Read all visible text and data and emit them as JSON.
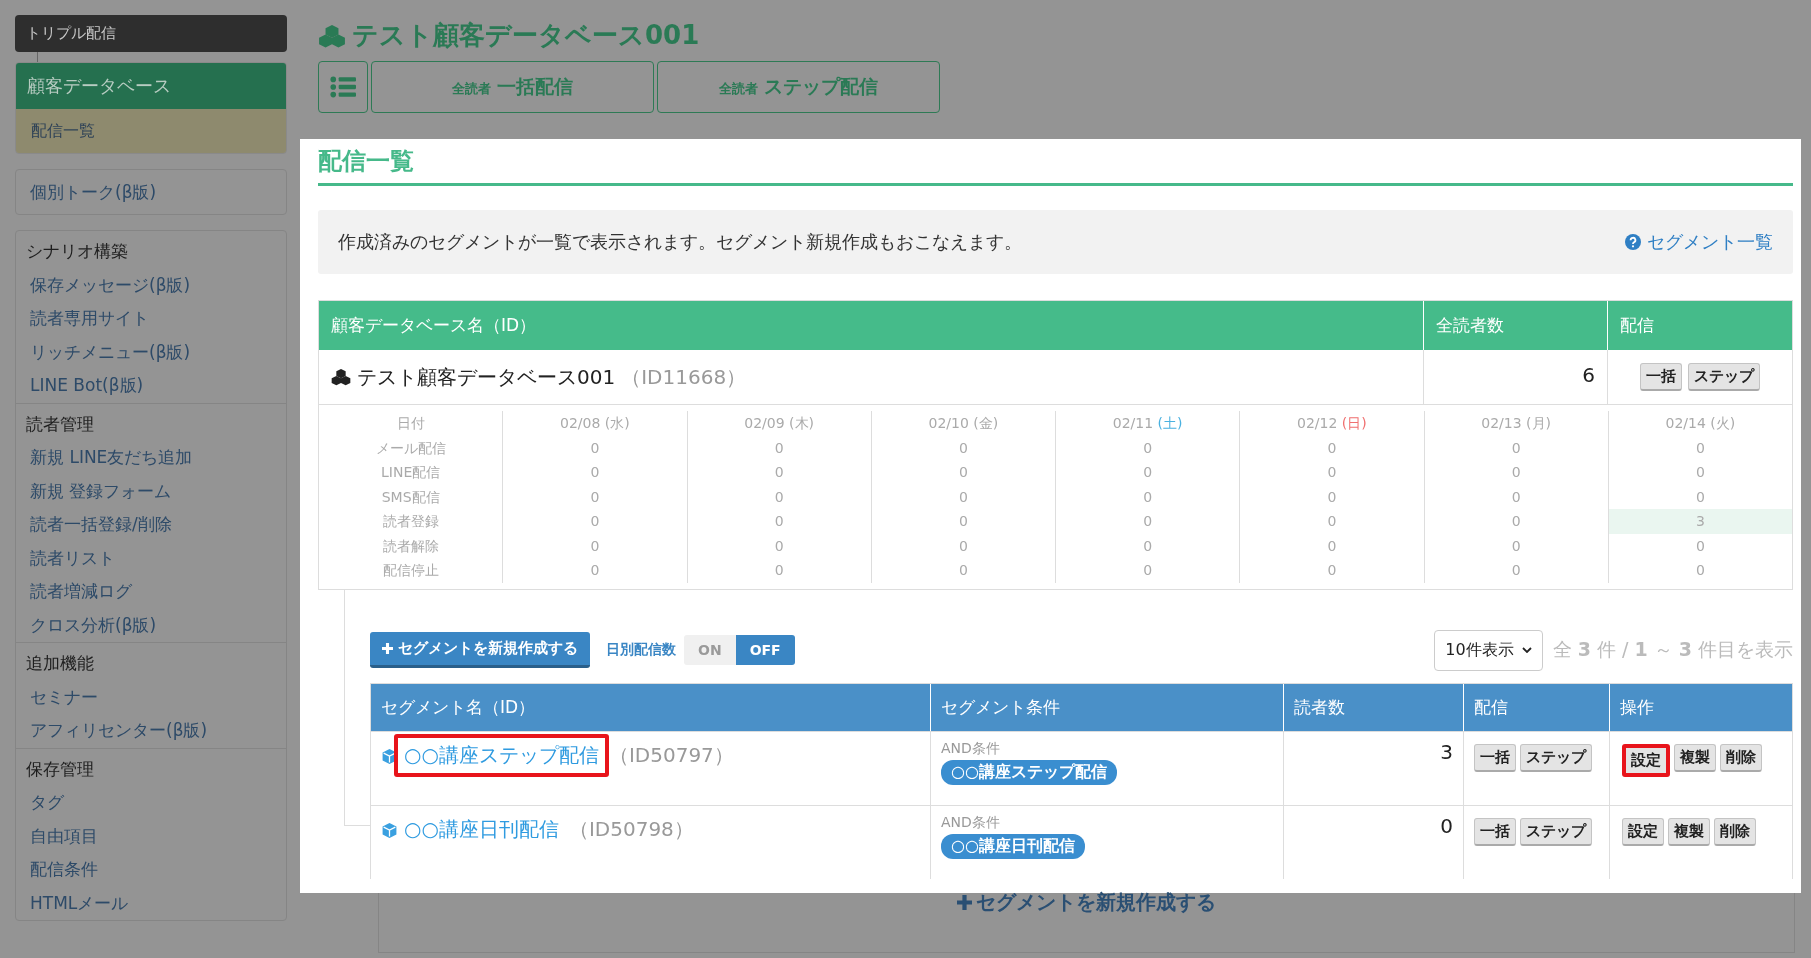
{
  "sidebar": {
    "brand": "トリプル配信",
    "current_group": "顧客データベース",
    "current_item": "配信一覧",
    "single": "個別トーク(β版)",
    "sections": [
      {
        "title": "シナリオ構築",
        "items": [
          "保存メッセージ(β版)",
          "読者専用サイト",
          "リッチメニュー(β版)",
          "LINE Bot(β版)"
        ]
      },
      {
        "title": "読者管理",
        "items": [
          "新規 LINE友だち追加",
          "新規 登録フォーム",
          "読者一括登録/削除",
          "読者リスト",
          "読者増減ログ",
          "クロス分析(β版)"
        ]
      },
      {
        "title": "追加機能",
        "items": [
          "セミナー",
          "アフィリセンター(β版)"
        ]
      },
      {
        "title": "保存管理",
        "items": [
          "タグ",
          "自由項目",
          "配信条件",
          "HTMLメール"
        ]
      }
    ]
  },
  "page_title": "テスト顧客データベース001",
  "top_buttons": [
    {
      "small": "全読者",
      "label": "一括配信"
    },
    {
      "small": "全読者",
      "label": "ステップ配信"
    }
  ],
  "panel": {
    "title": "配信一覧",
    "info": "作成済みのセグメントが一覧で表示されます。セグメント新規作成もおこなえます。",
    "help_link": "セグメント一覧",
    "db_table": {
      "columns": [
        "顧客データベース名（ID）",
        "全読者数",
        "配信"
      ],
      "name": "テスト顧客データベース001",
      "id": "（ID11668）",
      "count": "6",
      "buttons": [
        "一括",
        "ステップ"
      ]
    },
    "stats": {
      "corner": "日付",
      "days": [
        {
          "date": "02/08",
          "weekday": "(水)",
          "kind": "weekday"
        },
        {
          "date": "02/09",
          "weekday": "(木)",
          "kind": "weekday"
        },
        {
          "date": "02/10",
          "weekday": "(金)",
          "kind": "weekday"
        },
        {
          "date": "02/11",
          "weekday": "(土)",
          "kind": "saturday"
        },
        {
          "date": "02/12",
          "weekday": "(日)",
          "kind": "sunday"
        },
        {
          "date": "02/13",
          "weekday": "(月)",
          "kind": "weekday"
        },
        {
          "date": "02/14",
          "weekday": "(火)",
          "kind": "weekday"
        }
      ],
      "rows": [
        {
          "label": "メール配信",
          "values": [
            {
              "value": "0",
              "highlighted": false
            },
            {
              "value": "0",
              "highlighted": false
            },
            {
              "value": "0",
              "highlighted": false
            },
            {
              "value": "0",
              "highlighted": false
            },
            {
              "value": "0",
              "highlighted": false
            },
            {
              "value": "0",
              "highlighted": false
            },
            {
              "value": "0",
              "highlighted": false
            }
          ]
        },
        {
          "label": "LINE配信",
          "values": [
            {
              "value": "0",
              "highlighted": false
            },
            {
              "value": "0",
              "highlighted": false
            },
            {
              "value": "0",
              "highlighted": false
            },
            {
              "value": "0",
              "highlighted": false
            },
            {
              "value": "0",
              "highlighted": false
            },
            {
              "value": "0",
              "highlighted": false
            },
            {
              "value": "0",
              "highlighted": false
            }
          ]
        },
        {
          "label": "SMS配信",
          "values": [
            {
              "value": "0",
              "highlighted": false
            },
            {
              "value": "0",
              "highlighted": false
            },
            {
              "value": "0",
              "highlighted": false
            },
            {
              "value": "0",
              "highlighted": false
            },
            {
              "value": "0",
              "highlighted": false
            },
            {
              "value": "0",
              "highlighted": false
            },
            {
              "value": "0",
              "highlighted": false
            }
          ]
        },
        {
          "label": "読者登録",
          "values": [
            {
              "value": "0",
              "highlighted": false
            },
            {
              "value": "0",
              "highlighted": false
            },
            {
              "value": "0",
              "highlighted": false
            },
            {
              "value": "0",
              "highlighted": false
            },
            {
              "value": "0",
              "highlighted": false
            },
            {
              "value": "0",
              "highlighted": false
            },
            {
              "value": "3",
              "highlighted": true
            }
          ]
        },
        {
          "label": "読者解除",
          "values": [
            {
              "value": "0",
              "highlighted": false
            },
            {
              "value": "0",
              "highlighted": false
            },
            {
              "value": "0",
              "highlighted": false
            },
            {
              "value": "0",
              "highlighted": false
            },
            {
              "value": "0",
              "highlighted": false
            },
            {
              "value": "0",
              "highlighted": false
            },
            {
              "value": "0",
              "highlighted": false
            }
          ]
        },
        {
          "label": "配信停止",
          "values": [
            {
              "value": "0",
              "highlighted": false
            },
            {
              "value": "0",
              "highlighted": false
            },
            {
              "value": "0",
              "highlighted": false
            },
            {
              "value": "0",
              "highlighted": false
            },
            {
              "value": "0",
              "highlighted": false
            },
            {
              "value": "0",
              "highlighted": false
            },
            {
              "value": "0",
              "highlighted": false
            }
          ]
        }
      ]
    },
    "new_segment_button": "セグメントを新規作成する",
    "daily_toggle": {
      "label": "日別配信数",
      "on_label": "ON",
      "off_label": "OFF",
      "on": false
    },
    "page_size": "10件表示",
    "pagination": "全 **3** 件 / **1** ～ **3** 件目を表示",
    "segment_table": {
      "columns": [
        "セグメント名（ID）",
        "セグメント条件",
        "読者数",
        "配信",
        "操作"
      ],
      "rows": [
        {
          "name": "○○講座ステップ配信",
          "id": "（ID50797）",
          "name_highlighted": true,
          "condition_label": "AND条件",
          "condition": "○○講座ステップ配信",
          "count": "3",
          "delivery": [
            "一括",
            "ステップ"
          ],
          "actions": [
            {
              "label": "設定",
              "highlighted": true
            },
            {
              "label": "複製",
              "highlighted": false
            },
            {
              "label": "削除",
              "highlighted": false
            }
          ]
        },
        {
          "name": "○○講座日刊配信",
          "id": "（ID50798）",
          "name_highlighted": false,
          "condition_label": "AND条件",
          "condition": "○○講座日刊配信",
          "count": "0",
          "delivery": [
            "一括",
            "ステップ"
          ],
          "actions": [
            {
              "label": "設定",
              "highlighted": false
            },
            {
              "label": "複製",
              "highlighted": false
            },
            {
              "label": "削除",
              "highlighted": false
            }
          ]
        }
      ]
    }
  },
  "footer_new_segment": "セグメントを新規作成する"
}
